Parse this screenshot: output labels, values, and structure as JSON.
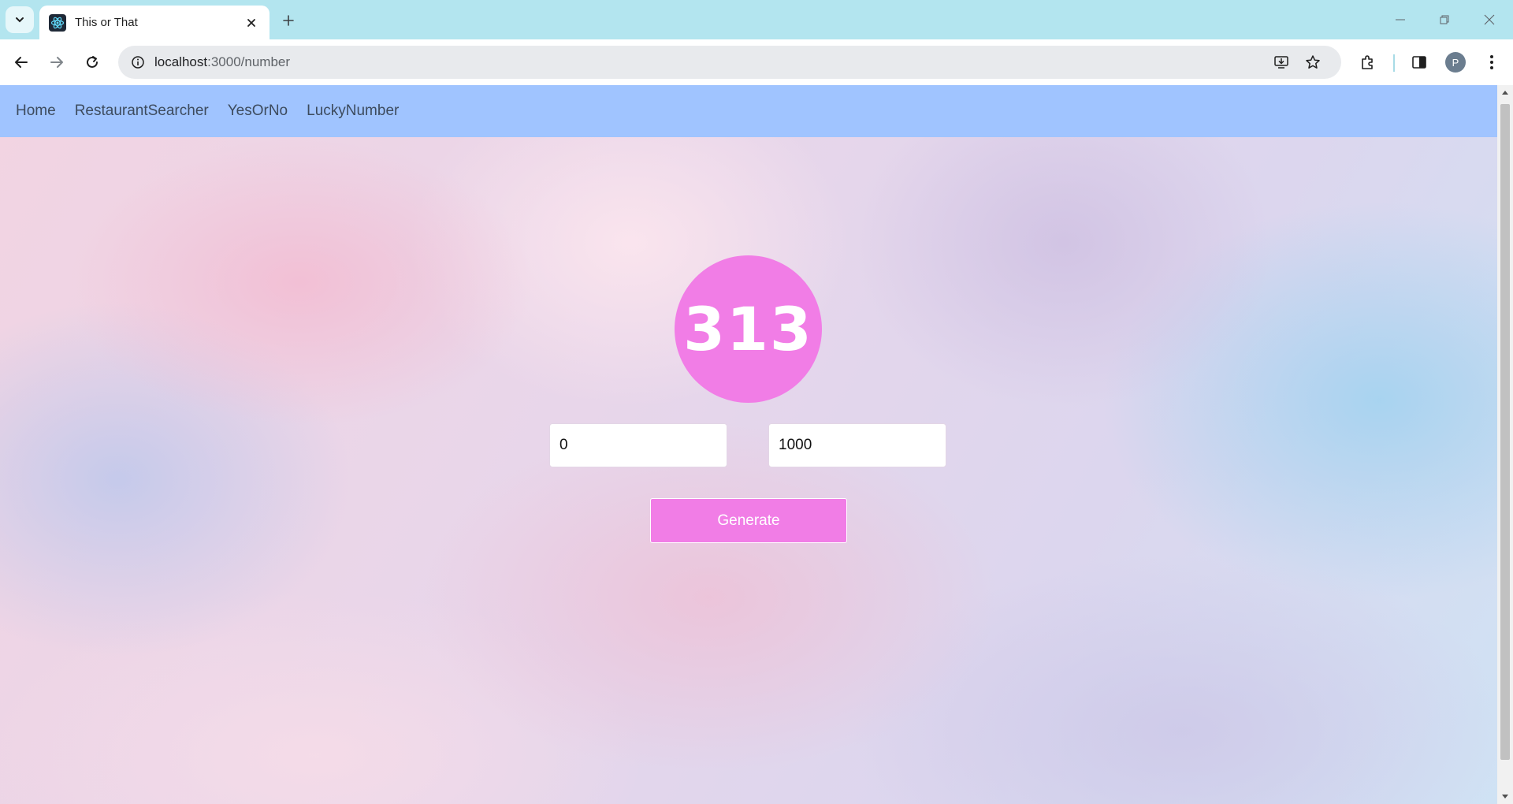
{
  "browser": {
    "tab": {
      "title": "This or That",
      "favicon": "react-logo-icon"
    },
    "address": {
      "host": "localhost",
      "path": ":3000/number"
    },
    "profile_initial": "P"
  },
  "nav": {
    "links": [
      {
        "label": "Home"
      },
      {
        "label": "RestaurantSearcher"
      },
      {
        "label": "YesOrNo"
      },
      {
        "label": "LuckyNumber"
      }
    ]
  },
  "lucky": {
    "value": "313",
    "min_value": "0",
    "max_value": "1000",
    "generate_label": "Generate"
  },
  "colors": {
    "navbar": "#a0c4ff",
    "accent": "#f17de6",
    "tabstrip": "#b3e5ef"
  }
}
